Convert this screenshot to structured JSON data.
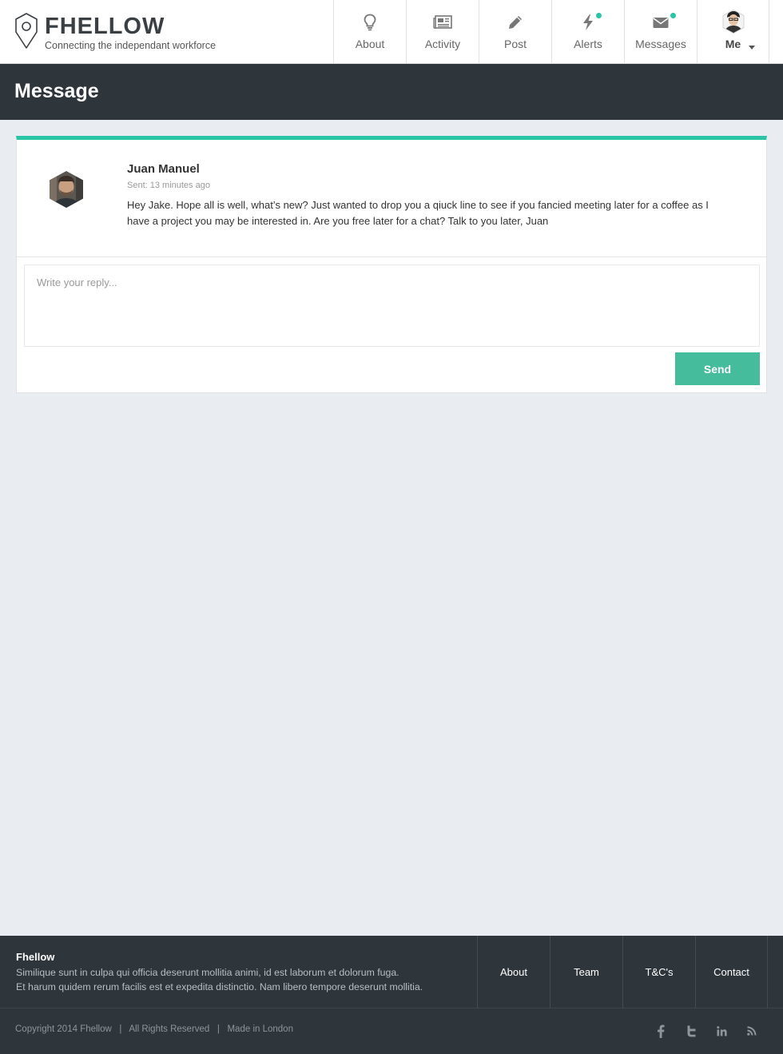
{
  "brand": {
    "name": "FHELLOW",
    "tagline": "Connecting the independant workforce"
  },
  "nav": {
    "items": [
      {
        "label": "About",
        "icon": "lightbulb-icon"
      },
      {
        "label": "Activity",
        "icon": "newspaper-icon"
      },
      {
        "label": "Post",
        "icon": "pencil-icon"
      },
      {
        "label": "Alerts",
        "icon": "lightning-icon",
        "notification": true
      },
      {
        "label": "Messages",
        "icon": "envelope-icon",
        "notification": true
      },
      {
        "label": "Me",
        "icon": "avatar"
      }
    ]
  },
  "page": {
    "title": "Message"
  },
  "message": {
    "sender": "Juan Manuel",
    "sent": "Sent: 13 minutes ago",
    "body": "Hey Jake.  Hope all is well, what’s new? Just wanted to drop you a qiuck line to see if you fancied meeting later for a coffee as I have a project you may be interested in. Are you free later for a chat? Talk to you later, Juan"
  },
  "reply": {
    "placeholder": "Write your reply...",
    "value": "",
    "send_label": "Send"
  },
  "footer": {
    "title": "Fhellow",
    "line1": "Similique sunt in culpa qui officia deserunt mollitia animi, id est laborum et dolorum fuga.",
    "line2": "Et harum quidem rerum facilis est et expedita distinctio. Nam libero tempore deserunt mollitia.",
    "links": [
      "About",
      "Team",
      "T&C's",
      "Contact"
    ],
    "copyright": "Copyright 2014 Fhellow   |   All Rights Reserved   |   Made in London",
    "social": [
      "facebook-icon",
      "twitter-icon",
      "linkedin-icon",
      "rss-icon"
    ]
  },
  "colors": {
    "accent": "#2ac4a6",
    "send_button": "#45bc9c",
    "dark_band": "#2e353b",
    "background": "#e9ecf0"
  }
}
